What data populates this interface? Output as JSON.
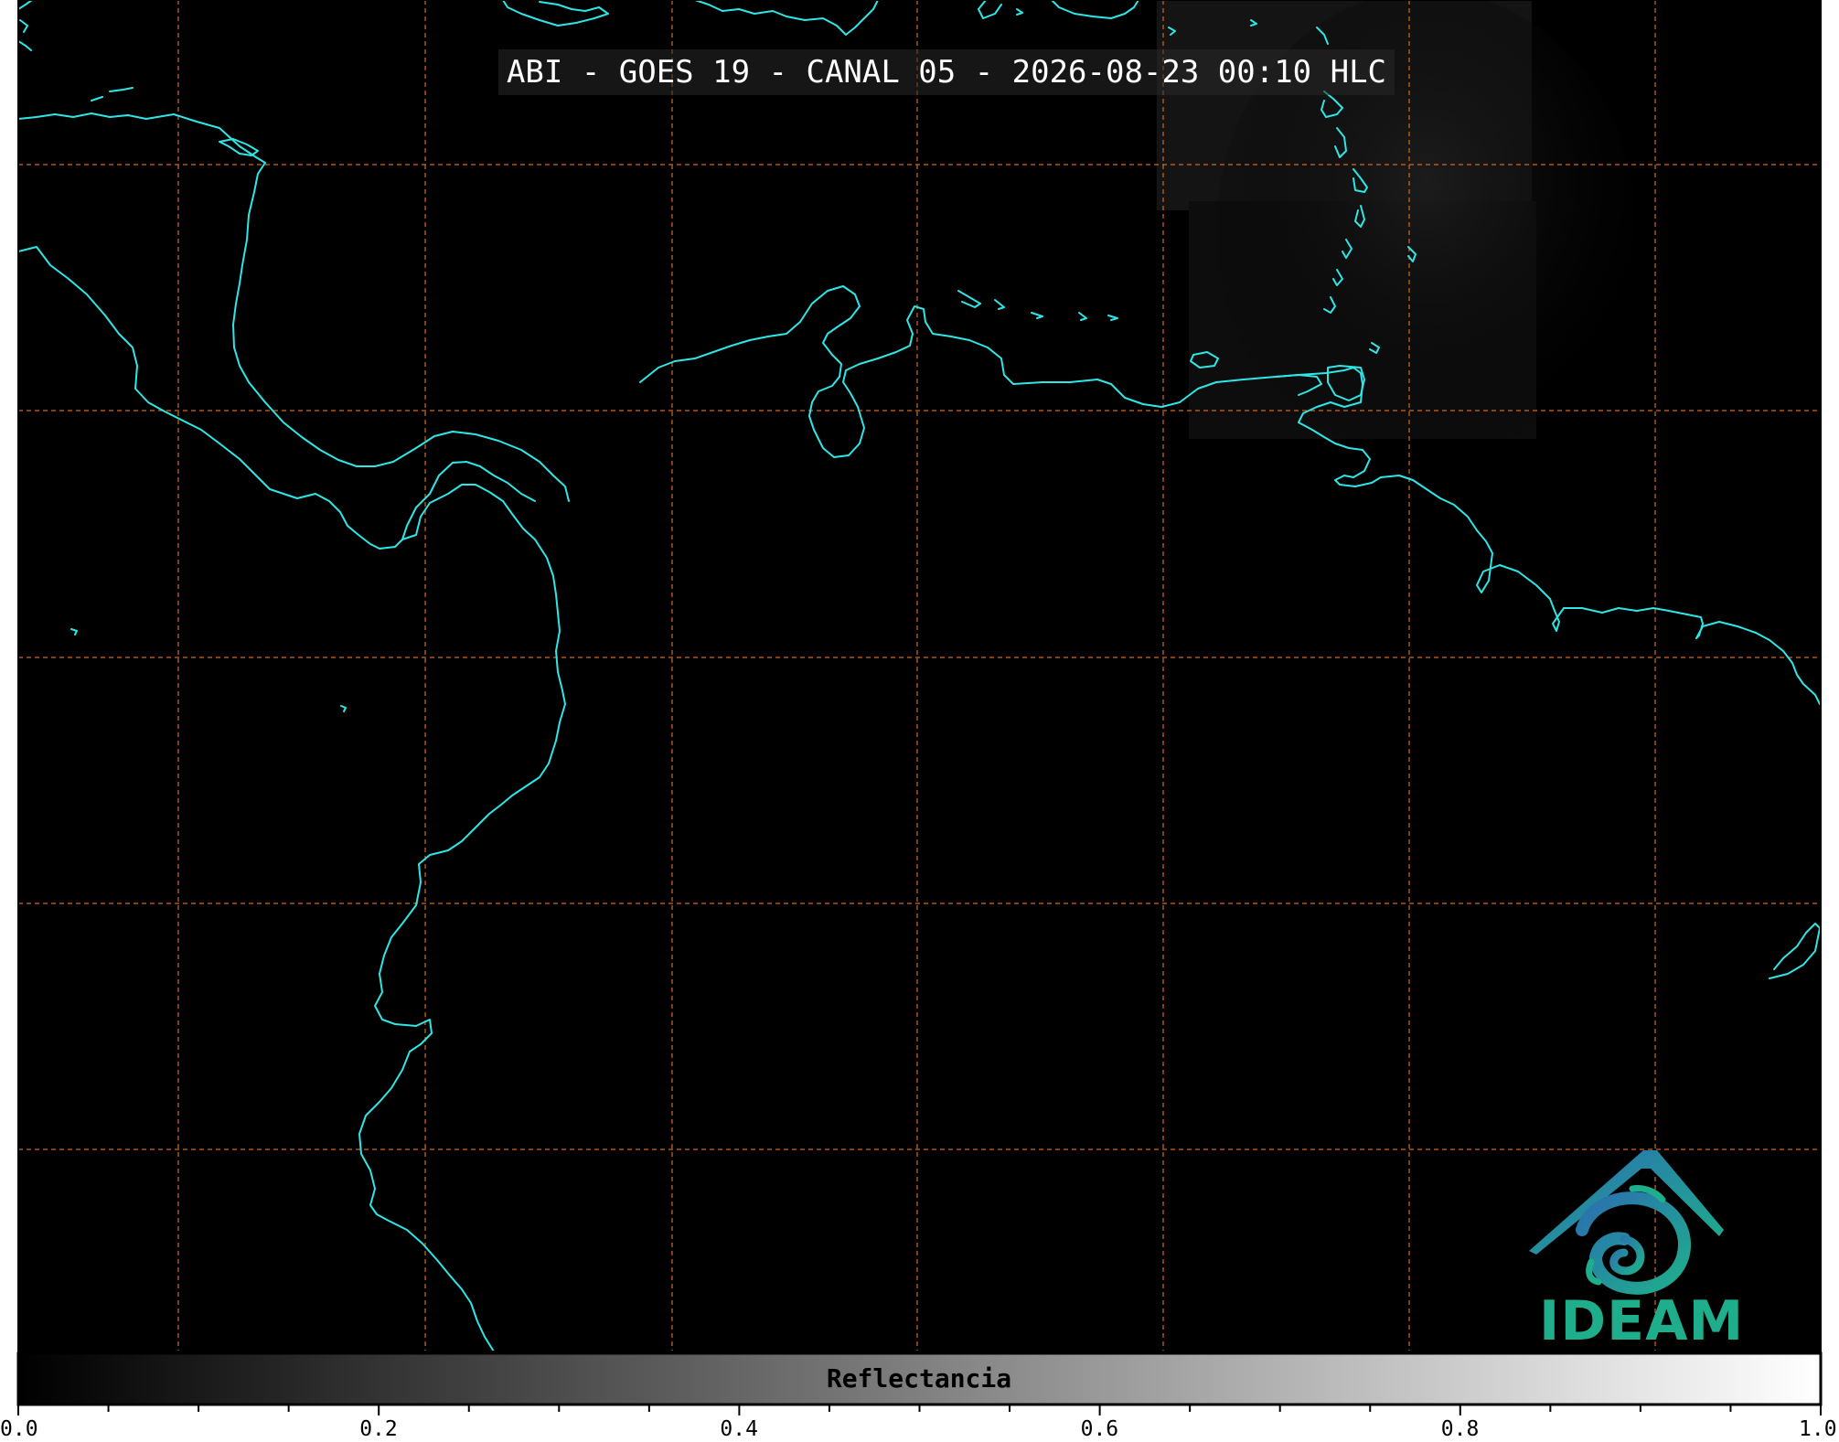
{
  "title": "ABI - GOES 19 - CANAL 05 - 2026-08-23 00:10 HLC",
  "colorbar": {
    "label": "Reflectancia",
    "tick_labels": [
      "0.0",
      "0.2",
      "0.4",
      "0.6",
      "0.8",
      "1.0"
    ],
    "range": [
      0.0,
      1.0
    ],
    "colormap": [
      "#000000",
      "#ffffff"
    ]
  },
  "map": {
    "background": "#000000",
    "coastline_color": "#2ee6e6",
    "gridline_color": "#d2691e",
    "gridline_style": "dashed"
  },
  "logo": {
    "text": "IDEAM",
    "text_color": "#1fae8c",
    "icon": "ideam-mountain-swirl-icon",
    "icon_colors": [
      "#2a6fb0",
      "#1fae8c"
    ]
  }
}
